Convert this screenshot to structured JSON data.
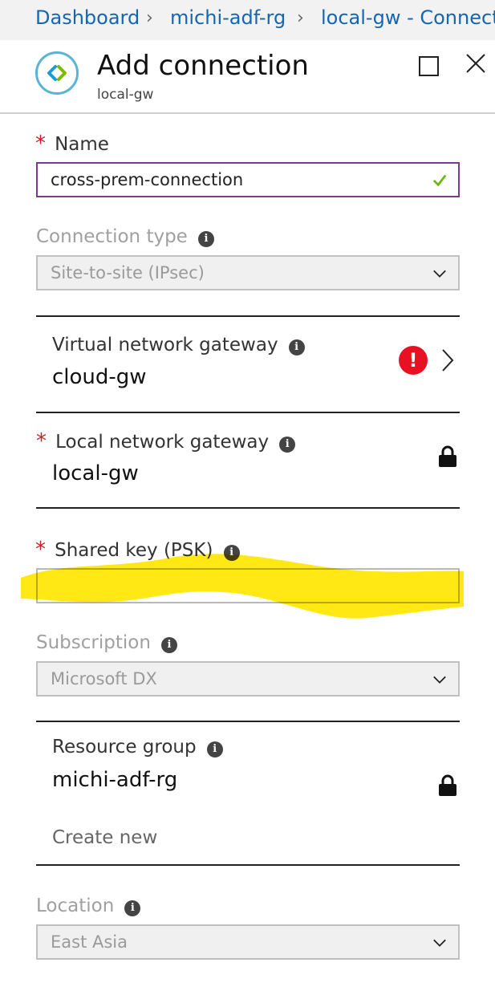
{
  "breadcrumb": [
    {
      "label": "Dashboard"
    },
    {
      "label": "michi-adf-rg"
    },
    {
      "label": "local-gw - Connections"
    }
  ],
  "blade": {
    "title": "Add connection",
    "subtitle": "local-gw"
  },
  "form": {
    "name": {
      "label": "Name",
      "value": "cross-prem-connection",
      "required": "*"
    },
    "connection_type": {
      "label": "Connection type",
      "value": "Site-to-site (IPsec)"
    },
    "vnet_gateway": {
      "label": "Virtual network gateway",
      "value": "cloud-gw",
      "status": "!"
    },
    "local_gateway": {
      "label": "Local network gateway",
      "value": "local-gw",
      "required": "*"
    },
    "shared_key": {
      "label": "Shared key (PSK)",
      "value": "",
      "required": "*"
    },
    "subscription": {
      "label": "Subscription",
      "value": "Microsoft DX"
    },
    "resource_group": {
      "label": "Resource group",
      "value": "michi-adf-rg",
      "create_new": "Create new"
    },
    "location": {
      "label": "Location",
      "value": "East Asia"
    }
  },
  "info_glyph": "i",
  "colors": {
    "link": "#1566b2",
    "required": "#c5232b",
    "active_border": "#7a3c8c",
    "valid_check": "#6bb700",
    "error": "#e81123",
    "highlight": "#ffe600"
  }
}
